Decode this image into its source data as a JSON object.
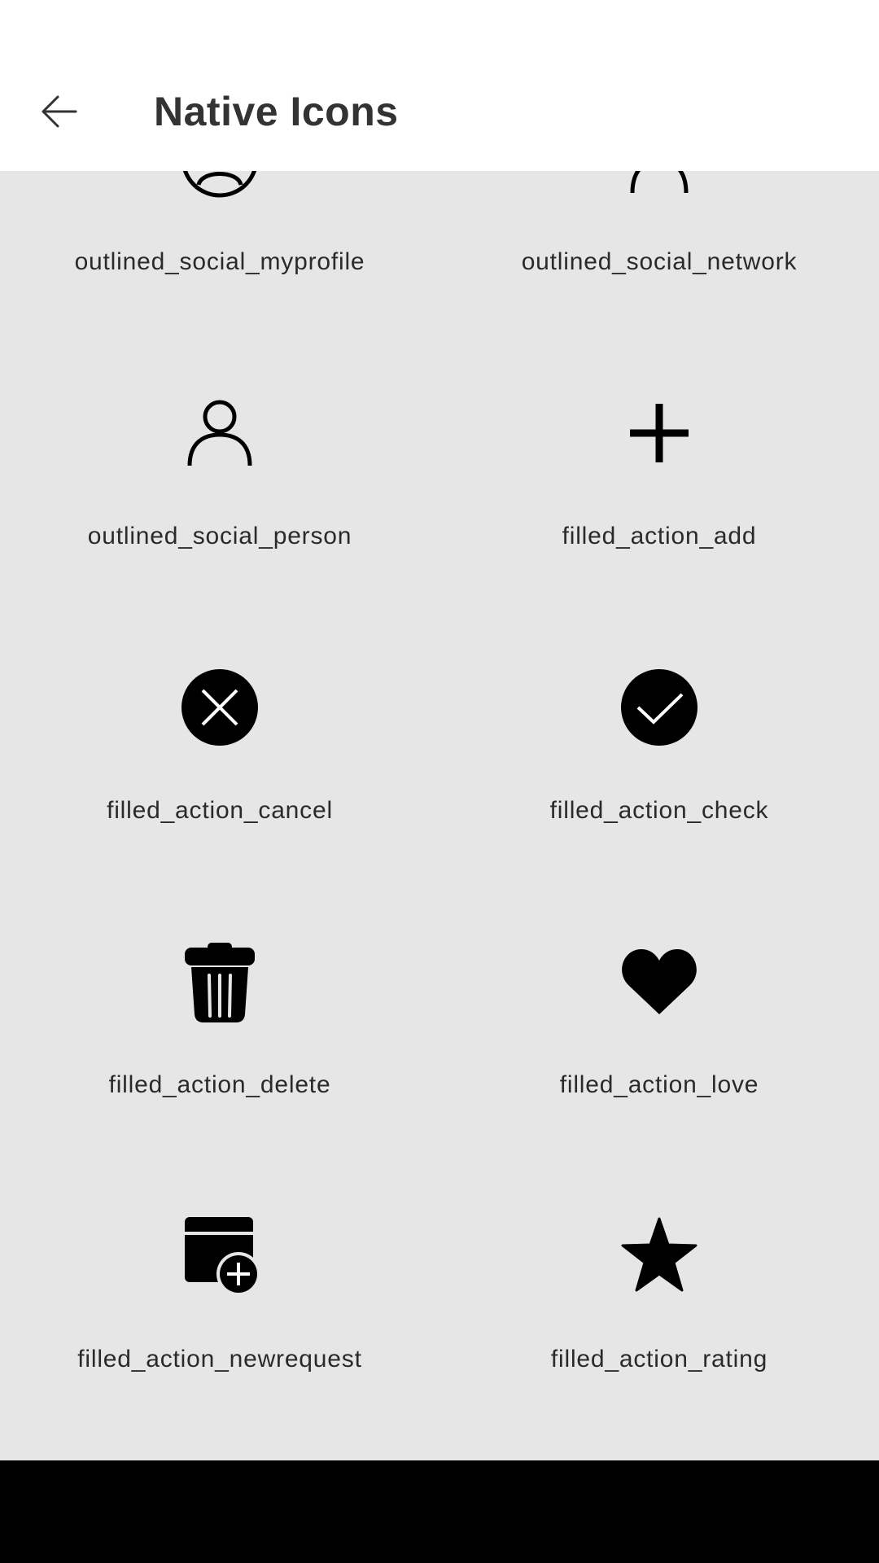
{
  "header": {
    "title": "Native Icons"
  },
  "icons": [
    {
      "label": "outlined_social_myprofile",
      "icon": "profile-circle-icon"
    },
    {
      "label": "outlined_social_network",
      "icon": "network-icon"
    },
    {
      "label": "outlined_social_person",
      "icon": "person-outline-icon"
    },
    {
      "label": "filled_action_add",
      "icon": "plus-icon"
    },
    {
      "label": "filled_action_cancel",
      "icon": "cancel-circle-icon"
    },
    {
      "label": "filled_action_check",
      "icon": "check-circle-icon"
    },
    {
      "label": "filled_action_delete",
      "icon": "trash-icon"
    },
    {
      "label": "filled_action_love",
      "icon": "heart-icon"
    },
    {
      "label": "filled_action_newrequest",
      "icon": "new-request-icon"
    },
    {
      "label": "filled_action_rating",
      "icon": "star-icon"
    }
  ]
}
